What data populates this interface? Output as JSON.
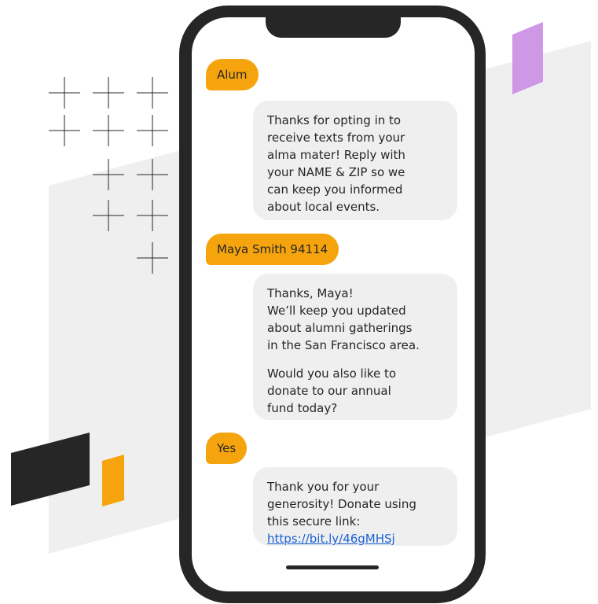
{
  "colors": {
    "accent_orange": "#f5a40e",
    "accent_purple": "#cf98e6",
    "phone_body": "#262626",
    "incoming_bubble": "#efefef",
    "link_blue": "#1a63d6",
    "backdrop_gray": "#efefef"
  },
  "conversation": {
    "sent_1": "Alum",
    "reply_1": [
      "Thanks for opting in to",
      "receive texts from your",
      "alma mater! Reply with",
      "your NAME & ZIP so we",
      "can keep you informed",
      "about local events."
    ],
    "sent_2": "Maya Smith 94114",
    "reply_2_p1": [
      "Thanks, Maya!",
      "We’ll keep you updated",
      "about alumni gatherings",
      "in the San Francisco area."
    ],
    "reply_2_p2": [
      "Would you also like to",
      "donate to our annual",
      "fund today?"
    ],
    "sent_3": "Yes",
    "reply_3": [
      "Thank you for your",
      "generosity! Donate using",
      "this secure link:"
    ],
    "reply_3_link": "https://bit.ly/46gMHSj"
  }
}
